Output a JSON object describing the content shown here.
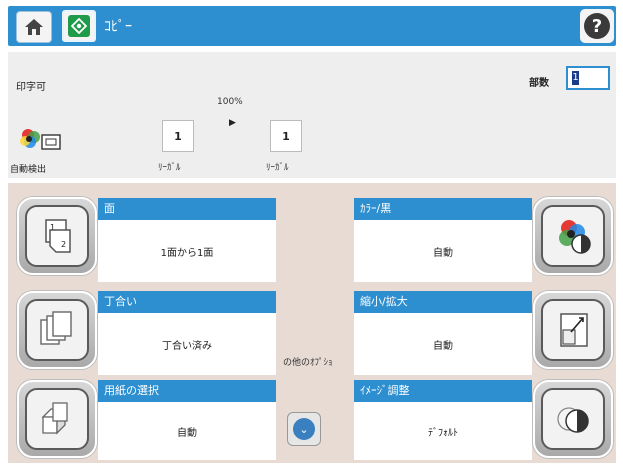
{
  "header": {
    "title": "ｺﾋﾟｰ",
    "home_icon": "home-icon",
    "start_icon": "copy-start-icon",
    "help_glyph": "?",
    "accent_color": "#2e8fd0"
  },
  "status": {
    "ready_text": "印字可",
    "copies_label": "部数",
    "copies_value": "1"
  },
  "preview": {
    "zoom": "100%",
    "original_pages": "1",
    "output_pages": "1",
    "original_paper": "ﾘｰｶﾞﾙ",
    "output_paper": "ﾘｰｶﾞﾙ",
    "color_mode_label": "自動検出"
  },
  "options": {
    "sides": {
      "title": "面",
      "value": "1面から1面"
    },
    "color": {
      "title": "ｶﾗｰ/黒",
      "value": "自動"
    },
    "collate": {
      "title": "丁合い",
      "value": "丁合い済み"
    },
    "reduce_enlarge": {
      "title": "縮小/拡大",
      "value": "自動"
    },
    "paper_select": {
      "title": "用紙の選択",
      "value": "自動"
    },
    "image_adjust": {
      "title": "ｲﾒｰｼﾞ調整",
      "value": "ﾃﾞﾌｫﾙﾄ"
    },
    "other_label": "の他のｵﾌﾟｼｮ",
    "more_glyph": "⌄"
  }
}
